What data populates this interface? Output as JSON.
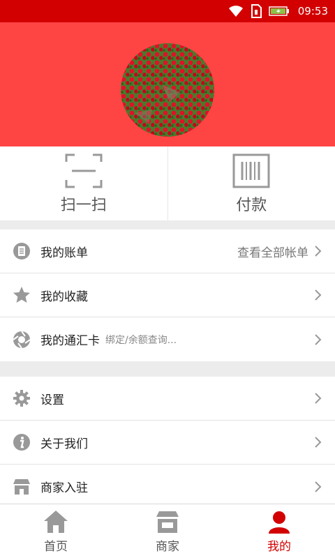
{
  "status_bar": {
    "time": "09:53"
  },
  "quick_actions": [
    {
      "label": "扫一扫",
      "icon": "scan-icon"
    },
    {
      "label": "付款",
      "icon": "barcode-icon"
    }
  ],
  "menu_group_1": [
    {
      "label": "我的账单",
      "hint": "查看全部帐单",
      "icon": "bill-icon"
    },
    {
      "label": "我的收藏",
      "icon": "star-icon"
    },
    {
      "label": "我的通汇卡",
      "sub": "绑定/余额查询...",
      "icon": "card-icon"
    }
  ],
  "menu_group_2": [
    {
      "label": "设置",
      "icon": "gear-icon"
    },
    {
      "label": "关于我们",
      "icon": "info-icon"
    },
    {
      "label": "商家入驻",
      "icon": "store-icon"
    }
  ],
  "tabbar": [
    {
      "label": "首页",
      "icon": "home-icon",
      "active": false
    },
    {
      "label": "商家",
      "icon": "shop-icon",
      "active": false
    },
    {
      "label": "我的",
      "icon": "user-icon",
      "active": true
    }
  ],
  "colors": {
    "primary": "#d20000",
    "header": "#ff4444",
    "icon_gray": "#999999"
  }
}
